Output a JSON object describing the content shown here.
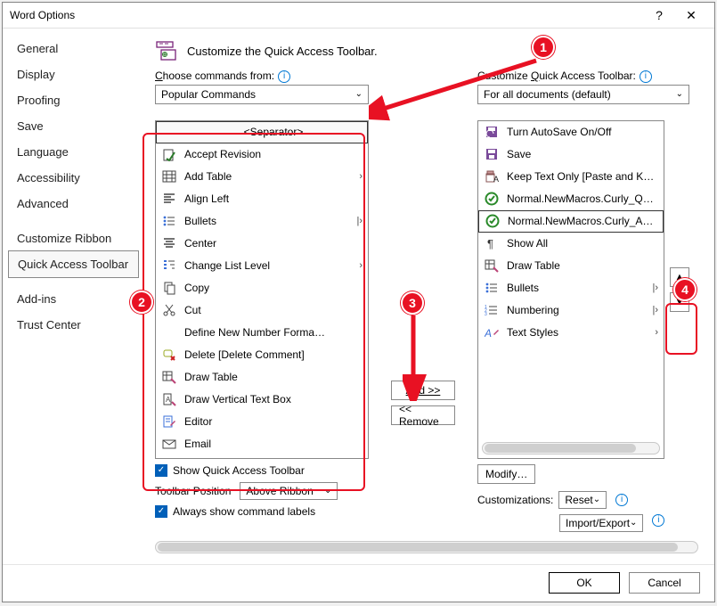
{
  "titlebar": {
    "title": "Word Options",
    "help": "?",
    "close": "✕"
  },
  "nav": {
    "items": [
      {
        "label": "General"
      },
      {
        "label": "Display"
      },
      {
        "label": "Proofing"
      },
      {
        "label": "Save"
      },
      {
        "label": "Language"
      },
      {
        "label": "Accessibility"
      },
      {
        "label": "Advanced"
      },
      {
        "label": "Customize Ribbon"
      },
      {
        "label": "Quick Access Toolbar"
      },
      {
        "label": "Add-ins"
      },
      {
        "label": "Trust Center"
      }
    ],
    "active_index": 8
  },
  "heading": "Customize the Quick Access Toolbar.",
  "left": {
    "label_pre": "C",
    "label_post": "hoose commands from:",
    "combo": "Popular Commands",
    "items": [
      {
        "icon": "sep",
        "label": "<Separator>",
        "sel_head": true
      },
      {
        "icon": "accept",
        "label": "Accept Revision"
      },
      {
        "icon": "table",
        "label": "Add Table",
        "sub": "›"
      },
      {
        "icon": "align-left",
        "label": "Align Left"
      },
      {
        "icon": "bullets",
        "label": "Bullets",
        "sub": "|›"
      },
      {
        "icon": "center",
        "label": "Center"
      },
      {
        "icon": "list-level",
        "label": "Change List Level",
        "sub": "›"
      },
      {
        "icon": "copy",
        "label": "Copy"
      },
      {
        "icon": "cut",
        "label": "Cut"
      },
      {
        "icon": "blank",
        "label": "Define New Number Forma…"
      },
      {
        "icon": "delete",
        "label": "Delete [Delete Comment]"
      },
      {
        "icon": "draw-table",
        "label": "Draw Table"
      },
      {
        "icon": "text-box",
        "label": "Draw Vertical Text Box"
      },
      {
        "icon": "editor",
        "label": "Editor"
      },
      {
        "icon": "email",
        "label": "Email"
      }
    ]
  },
  "right": {
    "label_pre": "Customize ",
    "label_u": "Q",
    "label_post": "uick Access Toolbar:",
    "combo": "For all documents (default)",
    "items": [
      {
        "icon": "autosave",
        "label": "Turn AutoSave On/Off"
      },
      {
        "icon": "save",
        "label": "Save"
      },
      {
        "icon": "keep-text",
        "label": "Keep Text Only [Paste and Keep…"
      },
      {
        "icon": "macro-ok",
        "label": "Normal.NewMacros.Curly_Quotes"
      },
      {
        "icon": "macro-ok",
        "label": "Normal.NewMacros.Curly_Apost",
        "sel_row": true
      },
      {
        "icon": "pilcrow",
        "label": "Show All"
      },
      {
        "icon": "draw-table",
        "label": "Draw Table"
      },
      {
        "icon": "bullets",
        "label": "Bullets",
        "sub": "|›"
      },
      {
        "icon": "numbering",
        "label": "Numbering",
        "sub": "|›"
      },
      {
        "icon": "text-styles",
        "label": "Text Styles",
        "sub": "›"
      }
    ]
  },
  "mid": {
    "add": "Add >>",
    "remove": "<< Remove"
  },
  "arrows": {
    "up": "▲",
    "down": "▼"
  },
  "below_left": {
    "show_qat": "Show Quick Access Toolbar",
    "position_label": "Toolbar Position",
    "position_value": "Above Ribbon",
    "always_labels": "Always show command labels"
  },
  "below_right": {
    "modify": "Modify…",
    "custom_label": "Customizations:",
    "reset": "Reset",
    "import": "Import/Export"
  },
  "footer": {
    "ok": "OK",
    "cancel": "Cancel"
  },
  "annotations": {
    "n1": "1",
    "n2": "2",
    "n3": "3",
    "n4": "4"
  }
}
